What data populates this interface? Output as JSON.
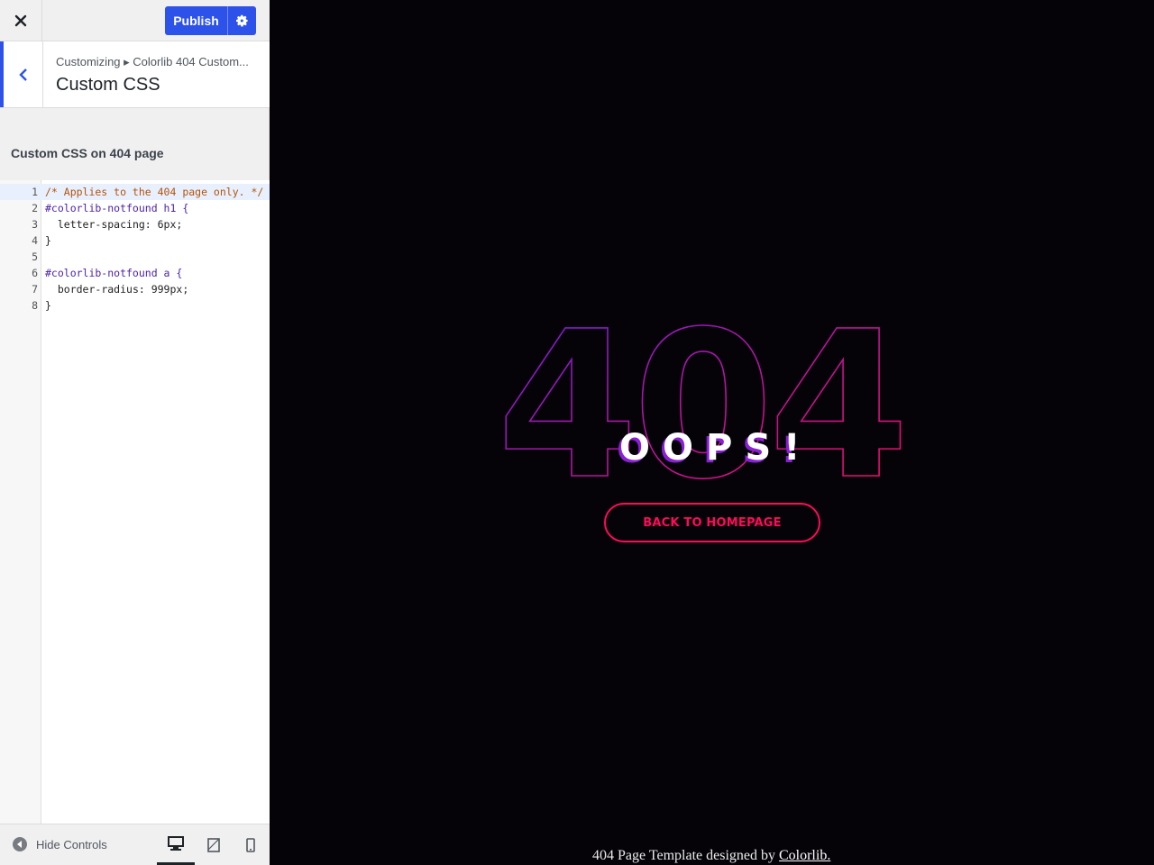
{
  "header": {
    "close_label": "Close",
    "publish_label": "Publish"
  },
  "section": {
    "breadcrumb": "Customizing ▸ Colorlib 404 Custom...",
    "title": "Custom CSS"
  },
  "editor": {
    "label": "Custom CSS on 404 page",
    "lines": [
      {
        "num": "1",
        "text": "/* Applies to the 404 page only. */"
      },
      {
        "num": "2",
        "text": "#colorlib-notfound h1 {"
      },
      {
        "num": "3",
        "text": "  letter-spacing: 6px;"
      },
      {
        "num": "4",
        "text": "}"
      },
      {
        "num": "5",
        "text": ""
      },
      {
        "num": "6",
        "text": "#colorlib-notfound a {"
      },
      {
        "num": "7",
        "text": "  border-radius: 999px;"
      },
      {
        "num": "8",
        "text": "}"
      }
    ]
  },
  "footer": {
    "hide_controls_label": "Hide Controls",
    "active_device": "desktop"
  },
  "preview": {
    "big_number": "404",
    "oops_text": "OOPS!",
    "home_button": "BACK TO HOMEPAGE",
    "credit_prefix": "404 Page Template designed by ",
    "credit_link": "Colorlib."
  },
  "colors": {
    "accent": "#2c52ea",
    "neon_pink": "#ff0a5a",
    "neon_purple": "#6a1fe0",
    "bg": "#050308"
  }
}
